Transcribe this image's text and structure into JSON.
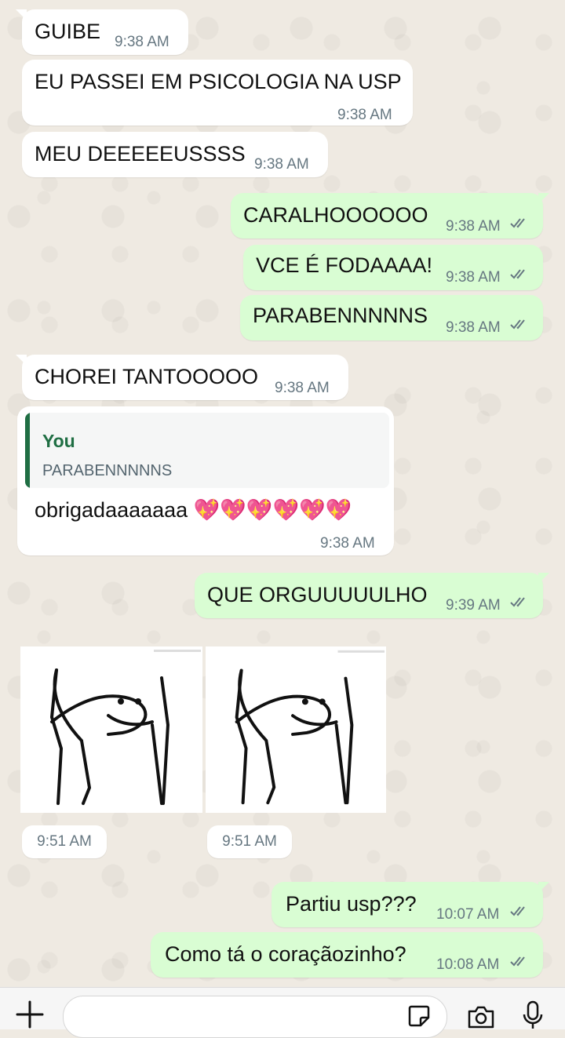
{
  "messages": [
    {
      "dir": "in",
      "text": "GUIBE",
      "time": "9:38 AM"
    },
    {
      "dir": "in",
      "text": "EU PASSEI EM PSICOLOGIA NA USP",
      "time": "9:38 AM"
    },
    {
      "dir": "in",
      "text": "MEU DEEEEEUSSSS",
      "time": "9:38 AM"
    },
    {
      "dir": "out",
      "text": "CARALHOOOOOO",
      "time": "9:38 AM"
    },
    {
      "dir": "out",
      "text": "VCE É FODAAAA!",
      "time": "9:38 AM"
    },
    {
      "dir": "out",
      "text": "PARABENNNNNS",
      "time": "9:38 AM"
    },
    {
      "dir": "in",
      "text": "CHOREI TANTOOOOO",
      "time": "9:38 AM"
    },
    {
      "dir": "in",
      "reply_author": "You",
      "reply_text": "PARABENNNNNS",
      "text": "obrigadaaaaaaa 💖💖💖💖💖💖",
      "time": "9:38 AM"
    },
    {
      "dir": "out",
      "text": "QUE ORGUUUUULHO",
      "time": "9:39 AM"
    },
    {
      "dir": "in",
      "sticker": "flork-arms-up-sticker",
      "time": "9:51 AM"
    },
    {
      "dir": "in",
      "sticker": "flork-arms-up-sticker",
      "time": "9:51 AM"
    },
    {
      "dir": "out",
      "text": "Partiu usp???",
      "time": "10:07 AM"
    },
    {
      "dir": "out",
      "text": "Como tá o coraçãozinho?",
      "time": "10:08 AM"
    }
  ],
  "status": {
    "read": "read-double-check"
  },
  "colors": {
    "incoming": "#ffffff",
    "outgoing": "#d9fdd3",
    "read_tick": "#667781",
    "reply_accent": "#1f6e43"
  },
  "input_bar": {
    "icons": [
      "plus-icon",
      "sticker-icon",
      "camera-icon",
      "microphone-icon"
    ]
  }
}
